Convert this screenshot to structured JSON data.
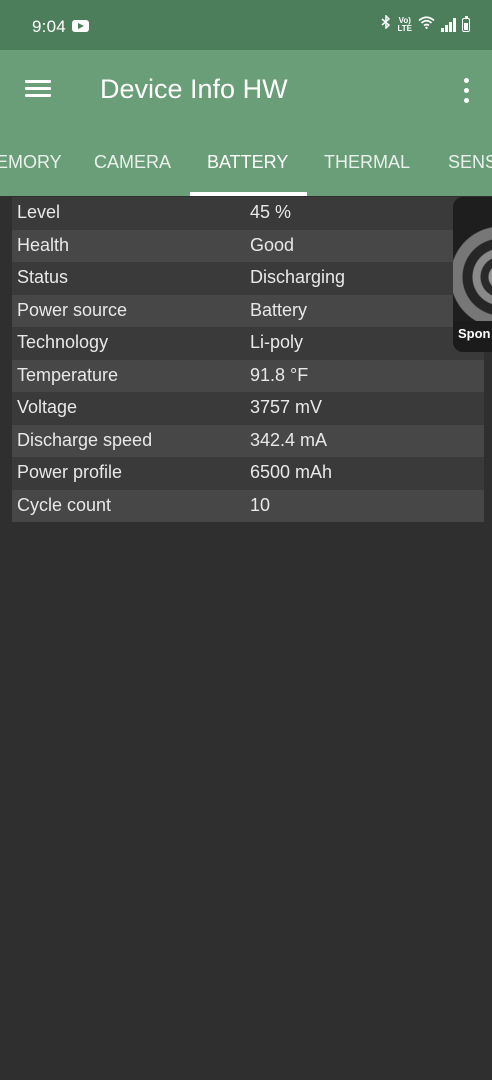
{
  "status_bar": {
    "time": "9:04",
    "icons": [
      "youtube-icon",
      "bluetooth-icon",
      "volte-icon",
      "wifi-icon",
      "signal-icon",
      "battery-icon"
    ],
    "volte_text": [
      "Vo)",
      "LTE"
    ]
  },
  "app_bar": {
    "title": "Device Info HW",
    "background": "#6a9e78",
    "status_background": "#4d7e5b"
  },
  "tabs": [
    {
      "label": "EMORY",
      "active": false
    },
    {
      "label": "CAMERA",
      "active": false
    },
    {
      "label": "BATTERY",
      "active": true
    },
    {
      "label": "THERMAL",
      "active": false
    },
    {
      "label": "SENS",
      "active": false
    }
  ],
  "battery_info": [
    {
      "key": "Level",
      "value": "45 %"
    },
    {
      "key": "Health",
      "value": "Good"
    },
    {
      "key": "Status",
      "value": "Discharging"
    },
    {
      "key": "Power source",
      "value": "Battery"
    },
    {
      "key": "Technology",
      "value": "Li-poly"
    },
    {
      "key": "Temperature",
      "value": "91.8 °F"
    },
    {
      "key": "Voltage",
      "value": "3757 mV"
    },
    {
      "key": "Discharge speed",
      "value": "342.4 mA"
    },
    {
      "key": "Power profile",
      "value": "6500 mAh"
    },
    {
      "key": "Cycle count",
      "value": "10"
    }
  ],
  "ad": {
    "label": "Spon"
  }
}
